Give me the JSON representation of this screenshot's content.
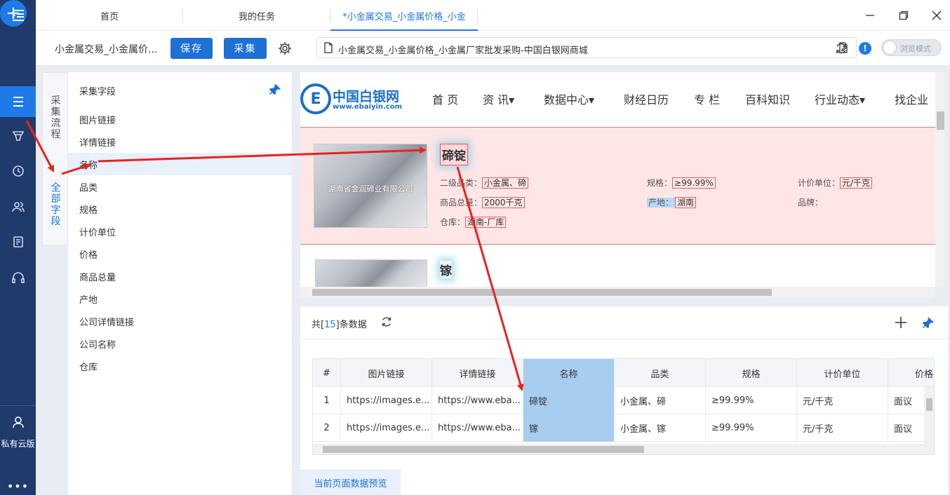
{
  "sidebar": {
    "user_label": "私有云版",
    "more": "•••"
  },
  "tabs": [
    {
      "label": "首页"
    },
    {
      "label": "我的任务"
    },
    {
      "label": "*小金属交易_小金属价格_小金"
    }
  ],
  "toolbar": {
    "task_name": "小金属交易_小金属价...",
    "save_label": "保存",
    "collect_label": "采集",
    "url": "小金属交易_小金属价格_小金属厂家批发采购-中国白银网商城",
    "browse_mode": "浏览模式"
  },
  "vtabs": {
    "flow": [
      "采",
      "集",
      "流",
      "程"
    ],
    "all_fields": [
      "全",
      "部",
      "字",
      "段"
    ]
  },
  "fields": {
    "title": "采集字段",
    "items": [
      "图片链接",
      "详情链接",
      "名称",
      "品类",
      "规格",
      "计价单位",
      "价格",
      "商品总量",
      "产地",
      "公司详情链接",
      "公司名称",
      "仓库"
    ]
  },
  "site": {
    "logo_text": "中国白银网",
    "logo_sub": "www.ebaiyin.com",
    "nav": [
      "首 页",
      "资 讯▾",
      "数据中心▾",
      "财经日历",
      "专 栏",
      "百科知识",
      "行业动态▾",
      "找企业"
    ]
  },
  "product1": {
    "image_overlay": "湖南省金润碲业有限公司",
    "title": "碲锭",
    "labels": {
      "category": "二级品类：",
      "spec": "规格：",
      "unit": "计价单位：",
      "total": "商品总量：",
      "origin": "产地：",
      "brand": "品牌：",
      "warehouse": "仓库："
    },
    "values": {
      "category": "小金属、碲",
      "spec": "≥99.99%",
      "unit": "元/千克",
      "total": "2000千克",
      "origin": "湖南",
      "warehouse": "湖南-厂库"
    }
  },
  "product2": {
    "title": "镓"
  },
  "data": {
    "count_prefix": "共[",
    "count": "15",
    "count_suffix": "]条数据",
    "columns": [
      "#",
      "图片链接",
      "详情链接",
      "名称",
      "品类",
      "规格",
      "计价单位",
      "价格"
    ],
    "rows": [
      [
        "1",
        "https://images.e...",
        "https://www.eba...",
        "碲锭",
        "小金属、碲",
        "≥99.99%",
        "元/千克",
        "面议"
      ],
      [
        "2",
        "https://images.e...",
        "https://www.eba...",
        "镓",
        "小金属、镓",
        "≥99.99%",
        "元/千克",
        "面议"
      ]
    ],
    "preview_tab": "当前页面数据预览"
  },
  "colors": {
    "accent": "#1e7ae6",
    "rail": "#1f3a6b",
    "arrow": "#e8231e"
  }
}
